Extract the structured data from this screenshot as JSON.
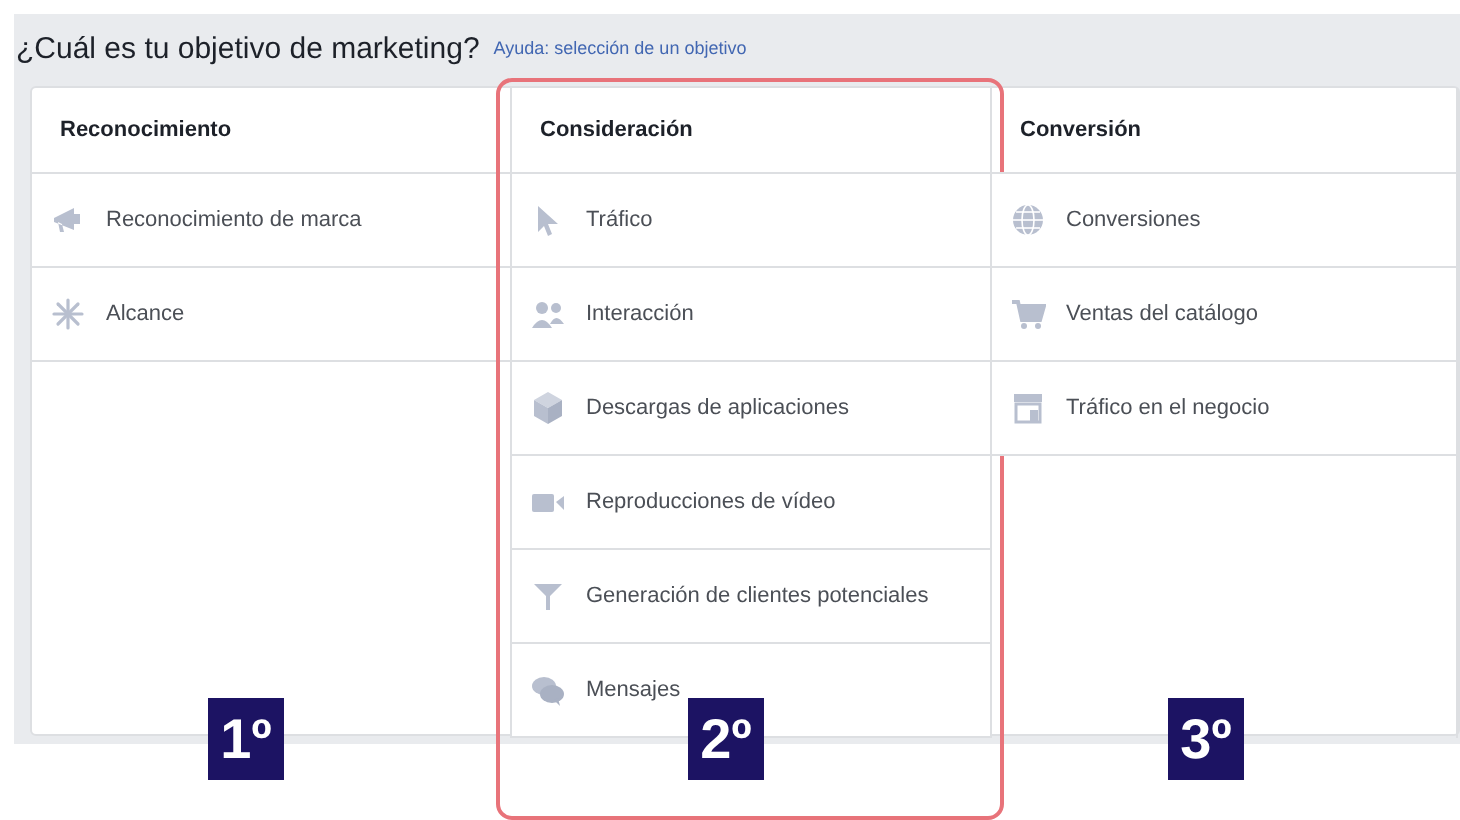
{
  "title": "¿Cuál es tu objetivo de marketing?",
  "help_link": "Ayuda: selección de un objetivo",
  "columns": [
    {
      "heading": "Reconocimiento",
      "highlighted": false,
      "badge": "1º",
      "items": [
        {
          "label": "Reconocimiento de marca"
        },
        {
          "label": "Alcance"
        }
      ]
    },
    {
      "heading": "Consideración",
      "highlighted": true,
      "badge": "2º",
      "items": [
        {
          "label": "Tráfico"
        },
        {
          "label": "Interacción"
        },
        {
          "label": "Descargas de aplicaciones"
        },
        {
          "label": "Reproducciones de vídeo"
        },
        {
          "label": "Generación de clientes potenciales"
        },
        {
          "label": "Mensajes"
        }
      ]
    },
    {
      "heading": "Conversión",
      "highlighted": false,
      "badge": "3º",
      "items": [
        {
          "label": "Conversiones"
        },
        {
          "label": "Ventas del catálogo"
        },
        {
          "label": "Tráfico en el negocio"
        }
      ]
    }
  ]
}
